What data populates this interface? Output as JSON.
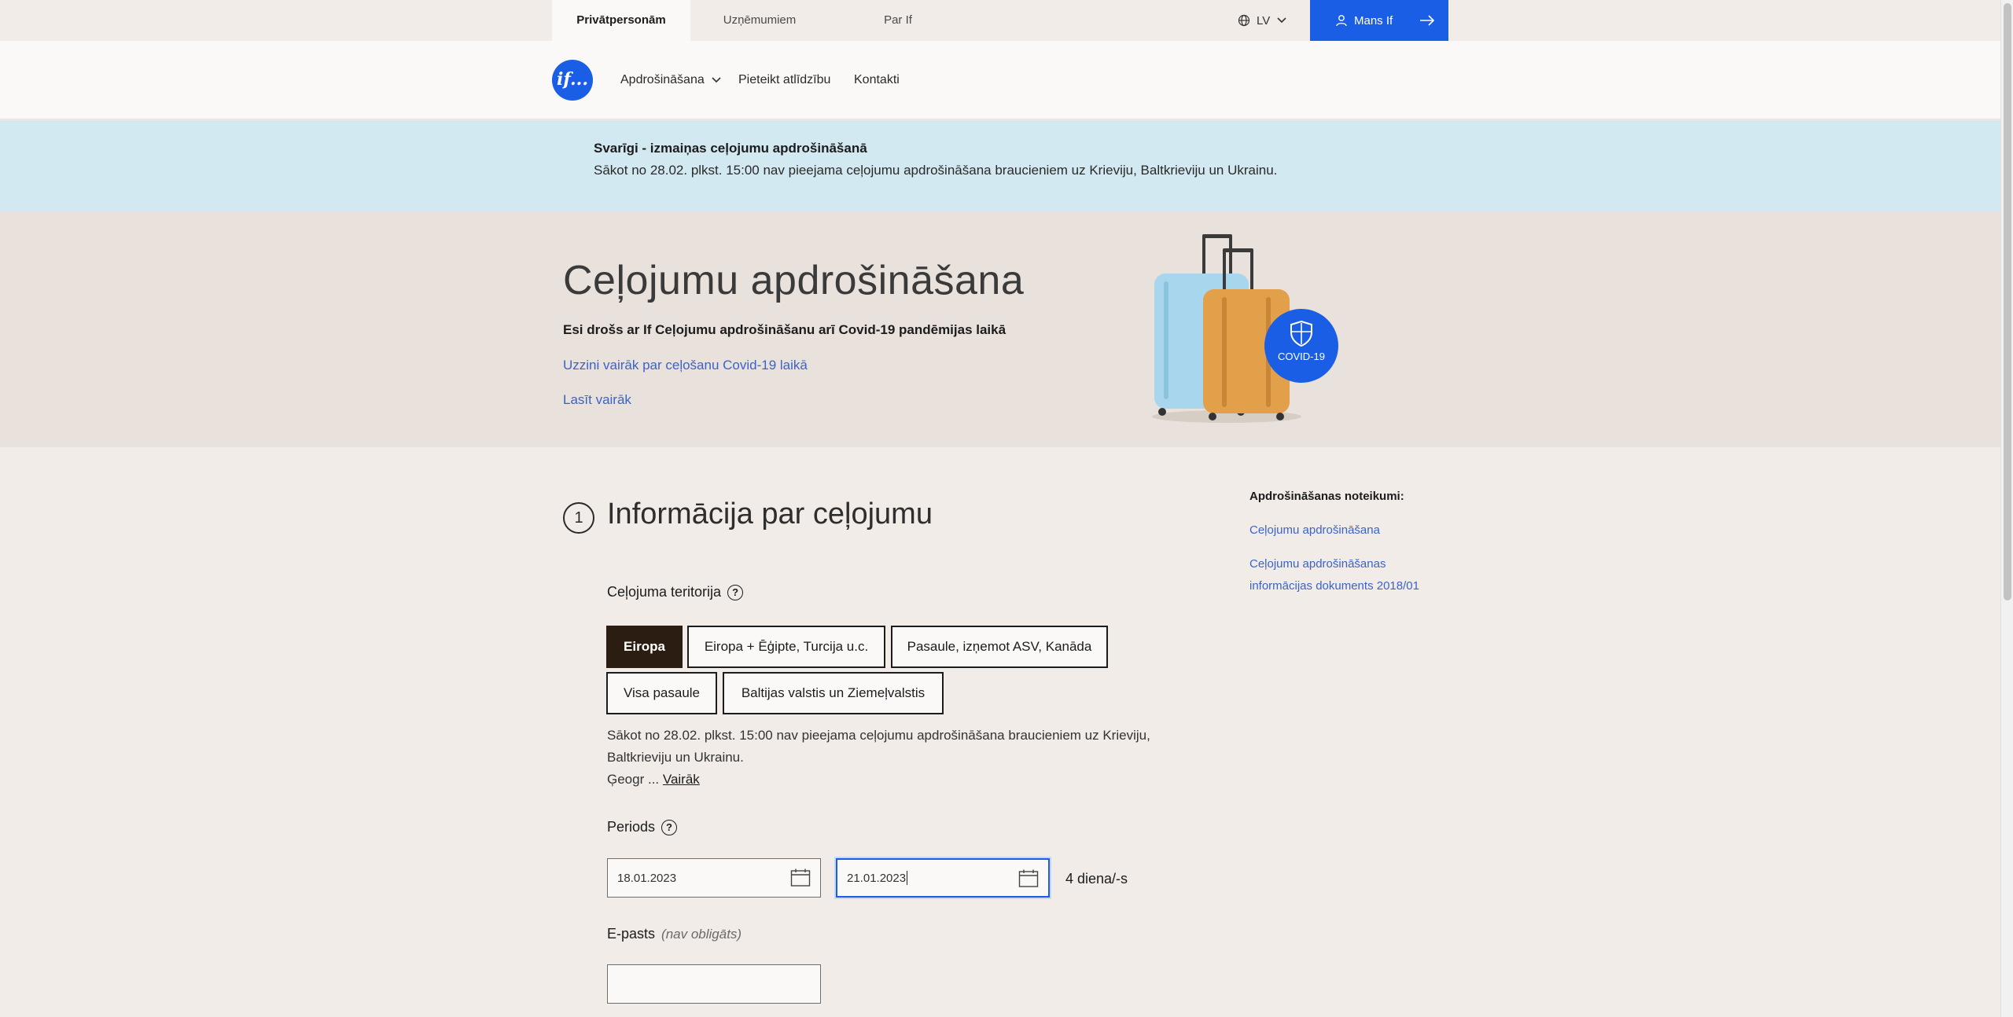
{
  "topbar": {
    "tabs": [
      {
        "label": "Privātpersonām"
      },
      {
        "label": "Uzņēmumiem"
      },
      {
        "label": "Par If"
      }
    ],
    "language": "LV",
    "account_label": "Mans If"
  },
  "header": {
    "logo_text": "if...",
    "nav": [
      {
        "label": "Apdrošināšana"
      },
      {
        "label": "Pieteikt atlīdzību"
      },
      {
        "label": "Kontakti"
      }
    ]
  },
  "notice": {
    "title": "Svarīgi - izmaiņas ceļojumu apdrošināšanā",
    "text": "Sākot no 28.02. plkst. 15:00 nav pieejama ceļojumu apdrošināšana braucieniem uz Krieviju, Baltkrieviju un Ukrainu."
  },
  "hero": {
    "title": "Ceļojumu apdrošināšana",
    "subtitle": "Esi drošs ar If Ceļojumu apdrošināšanu arī Covid-19 pandēmijas laikā",
    "link_covid": "Uzzini vairāk par ceļošanu Covid-19 laikā",
    "link_more": "Lasīt vairāk",
    "badge": "COVID-19"
  },
  "form": {
    "step_number": "1",
    "section_title": "Informācija par ceļojumu",
    "territory_label": "Ceļojuma teritorija",
    "territories": [
      {
        "label": "Eiropa",
        "selected": true
      },
      {
        "label": "Eiropa + Ēģipte, Turcija u.c.",
        "selected": false
      },
      {
        "label": "Pasaule, izņemot ASV, Kanāda",
        "selected": false
      },
      {
        "label": "Visa pasaule",
        "selected": false
      },
      {
        "label": "Baltijas valstis un Ziemeļvalstis",
        "selected": false
      }
    ],
    "territory_note": "Sākot no 28.02. plkst. 15:00 nav pieejama ceļojumu apdrošināšana braucieniem uz Krieviju, Baltkrieviju un Ukrainu.",
    "territory_note_tail": "Ģeogr ...",
    "territory_note_more": "Vairāk",
    "period_label": "Periods",
    "date_from": "18.01.2023",
    "date_to": "21.01.2023",
    "days": "4 diena/-s",
    "email_label": "E-pasts",
    "email_optional": "(nav obligāts)",
    "email_value": ""
  },
  "sidebar": {
    "title": "Apdrošināšanas noteikumi:",
    "links": [
      {
        "label": "Ceļojumu apdrošināšana"
      },
      {
        "label": "Ceļojumu apdrošināšanas informācijas dokuments 2018/01"
      }
    ]
  },
  "colors": {
    "brand_blue": "#1b5ee6",
    "notice_bg": "#d2e9f2",
    "hero_bg": "#e8e1dc",
    "selected_btn": "#2b1d12",
    "link": "#3b63c9"
  }
}
